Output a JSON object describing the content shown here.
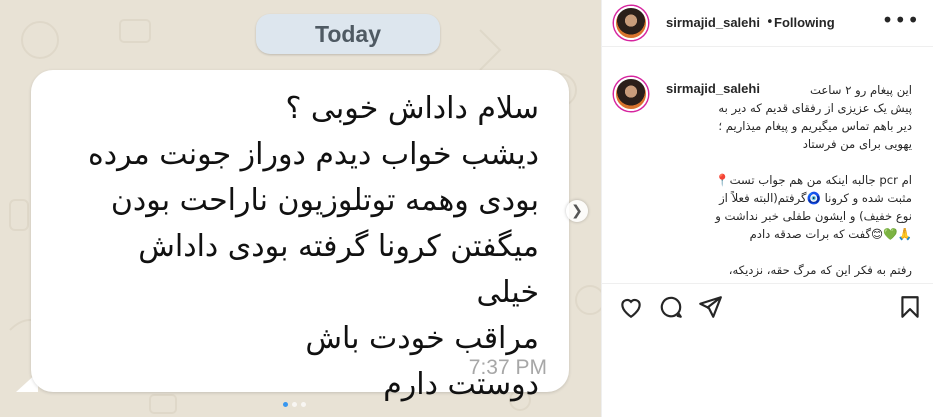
{
  "post": {
    "date_label": "Today",
    "message_lines": "سلام داداش خوبی ؟\nدیشب خواب دیدم دوراز جونت مرده\nبودی وهمه توتلوزیون ناراحت بودن\nمیگفتن کرونا گرفته بودی داداش خیلی\nمراقب خودت باش\nدوستت دارم",
    "message_time": "7:37 PM"
  },
  "header": {
    "username": "sirmajid_salehi",
    "separator": "•",
    "follow_status": "Following",
    "more_icon": "more-horizontal-icon"
  },
  "caption": {
    "username": "sirmajid_salehi",
    "text": "این پیغام رو ۲ ساعت\nپیش یک عزیزی از رفقای قدیم که دیر به\nدیر باهم تماس میگیریم و پیغام میذاریم ؛\nیهویی برای من فرستاد\n\nام pcr جالبه اینکه من هم جواب تست📍\nمثبت شده و کرونا 🧿گرفتم(البته فعلاً از\nنوع خفیف) و ایشون طفلی خبر نداشت و\n🙏💚😊گفت که برات صدقه دادم\n\nرفتم به فکر این که مرگ حقه، نزدیکه،"
  },
  "actions": [
    "heart-icon",
    "comment-icon",
    "share-icon",
    "bookmark-icon"
  ],
  "colors": {
    "accent": "#3897f0",
    "text": "#262626",
    "chat_bg": "#e8e2d5",
    "date_pill": "#dde6ee"
  }
}
